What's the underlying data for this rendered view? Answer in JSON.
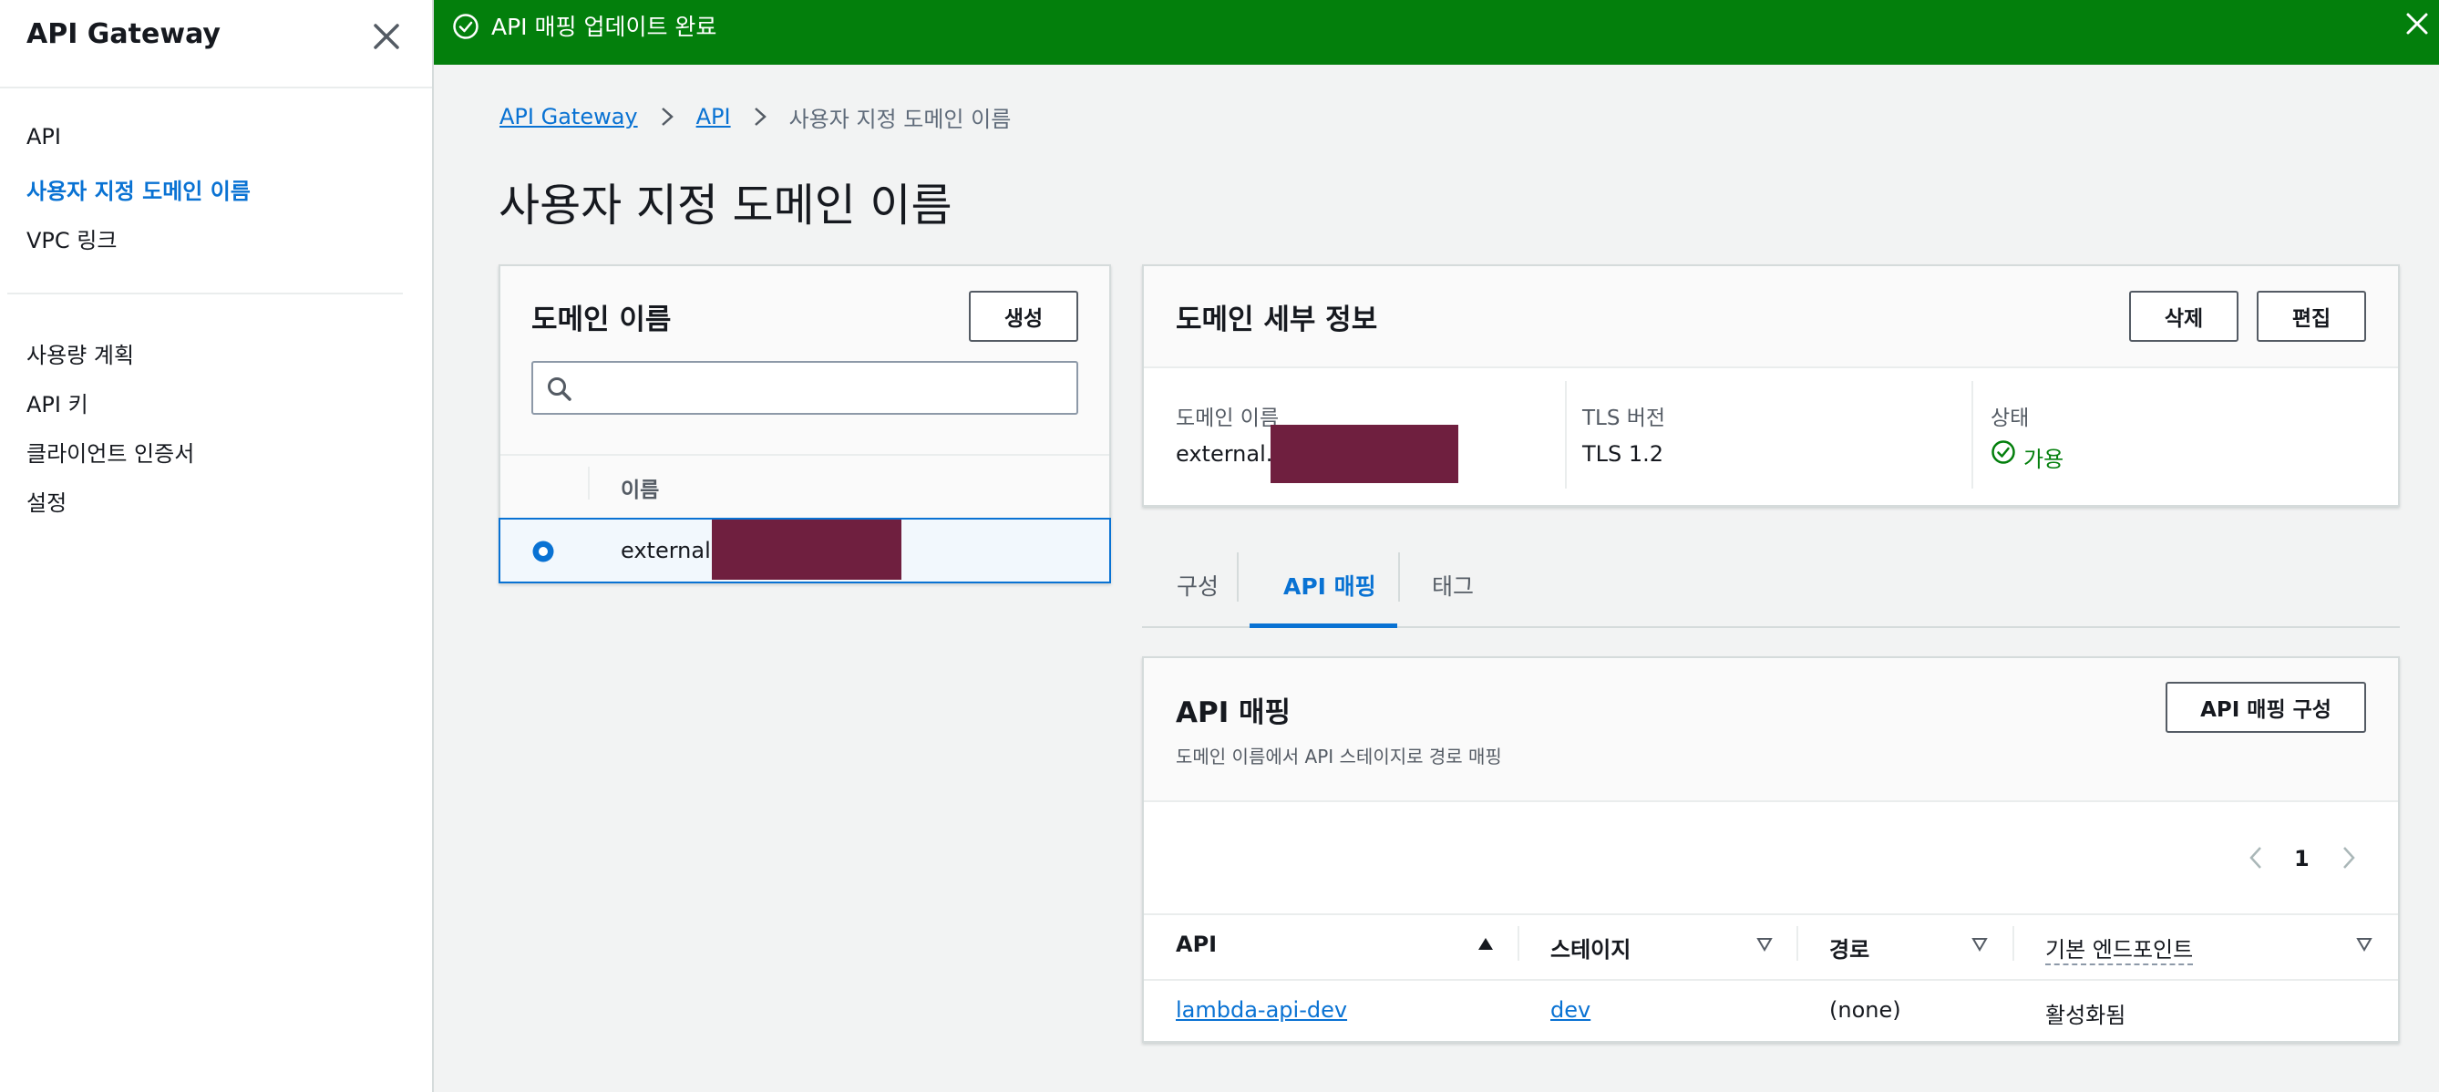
{
  "sidebar": {
    "title": "API Gateway",
    "items": [
      {
        "label": "API"
      },
      {
        "label": "사용자 지정 도메인 이름"
      },
      {
        "label": "VPC 링크"
      },
      {
        "label": "사용량 계획"
      },
      {
        "label": "API 키"
      },
      {
        "label": "클라이언트 인증서"
      },
      {
        "label": "설정"
      }
    ]
  },
  "flash": {
    "message": "API 매핑 업데이트 완료",
    "type": "success",
    "color": "#037f0c"
  },
  "breadcrumb": {
    "items": [
      "API Gateway",
      "API"
    ],
    "current": "사용자 지정 도메인 이름"
  },
  "page_title": "사용자 지정 도메인 이름",
  "domain_list": {
    "title": "도메인 이름",
    "create_label": "생성",
    "search_placeholder": "",
    "column_name": "이름",
    "rows": [
      {
        "name": "external.",
        "selected": true
      }
    ]
  },
  "domain_details": {
    "title": "도메인 세부 정보",
    "delete_label": "삭제",
    "edit_label": "편집",
    "fields": [
      {
        "label": "도메인 이름",
        "value": "external."
      },
      {
        "label": "TLS 버전",
        "value": "TLS 1.2"
      },
      {
        "label": "상태",
        "value": "가용"
      }
    ]
  },
  "tabs": [
    {
      "label": "구성"
    },
    {
      "label": "API 매핑",
      "active": true
    },
    {
      "label": "태그"
    }
  ],
  "api_mappings": {
    "title": "API 매핑",
    "description": "도메인 이름에서 API 스테이지로 경로 매핑",
    "configure_label": "API 매핑 구성",
    "page": "1",
    "columns": [
      "API",
      "스테이지",
      "경로",
      "기본 엔드포인트"
    ],
    "rows": [
      {
        "api": "lambda-api-dev",
        "stage": "dev",
        "path": "(none)",
        "endpoint": "활성화됨"
      }
    ]
  },
  "colors": {
    "accent": "#0972d3",
    "success": "#037f0c",
    "redaction": "#6f1f3f"
  }
}
